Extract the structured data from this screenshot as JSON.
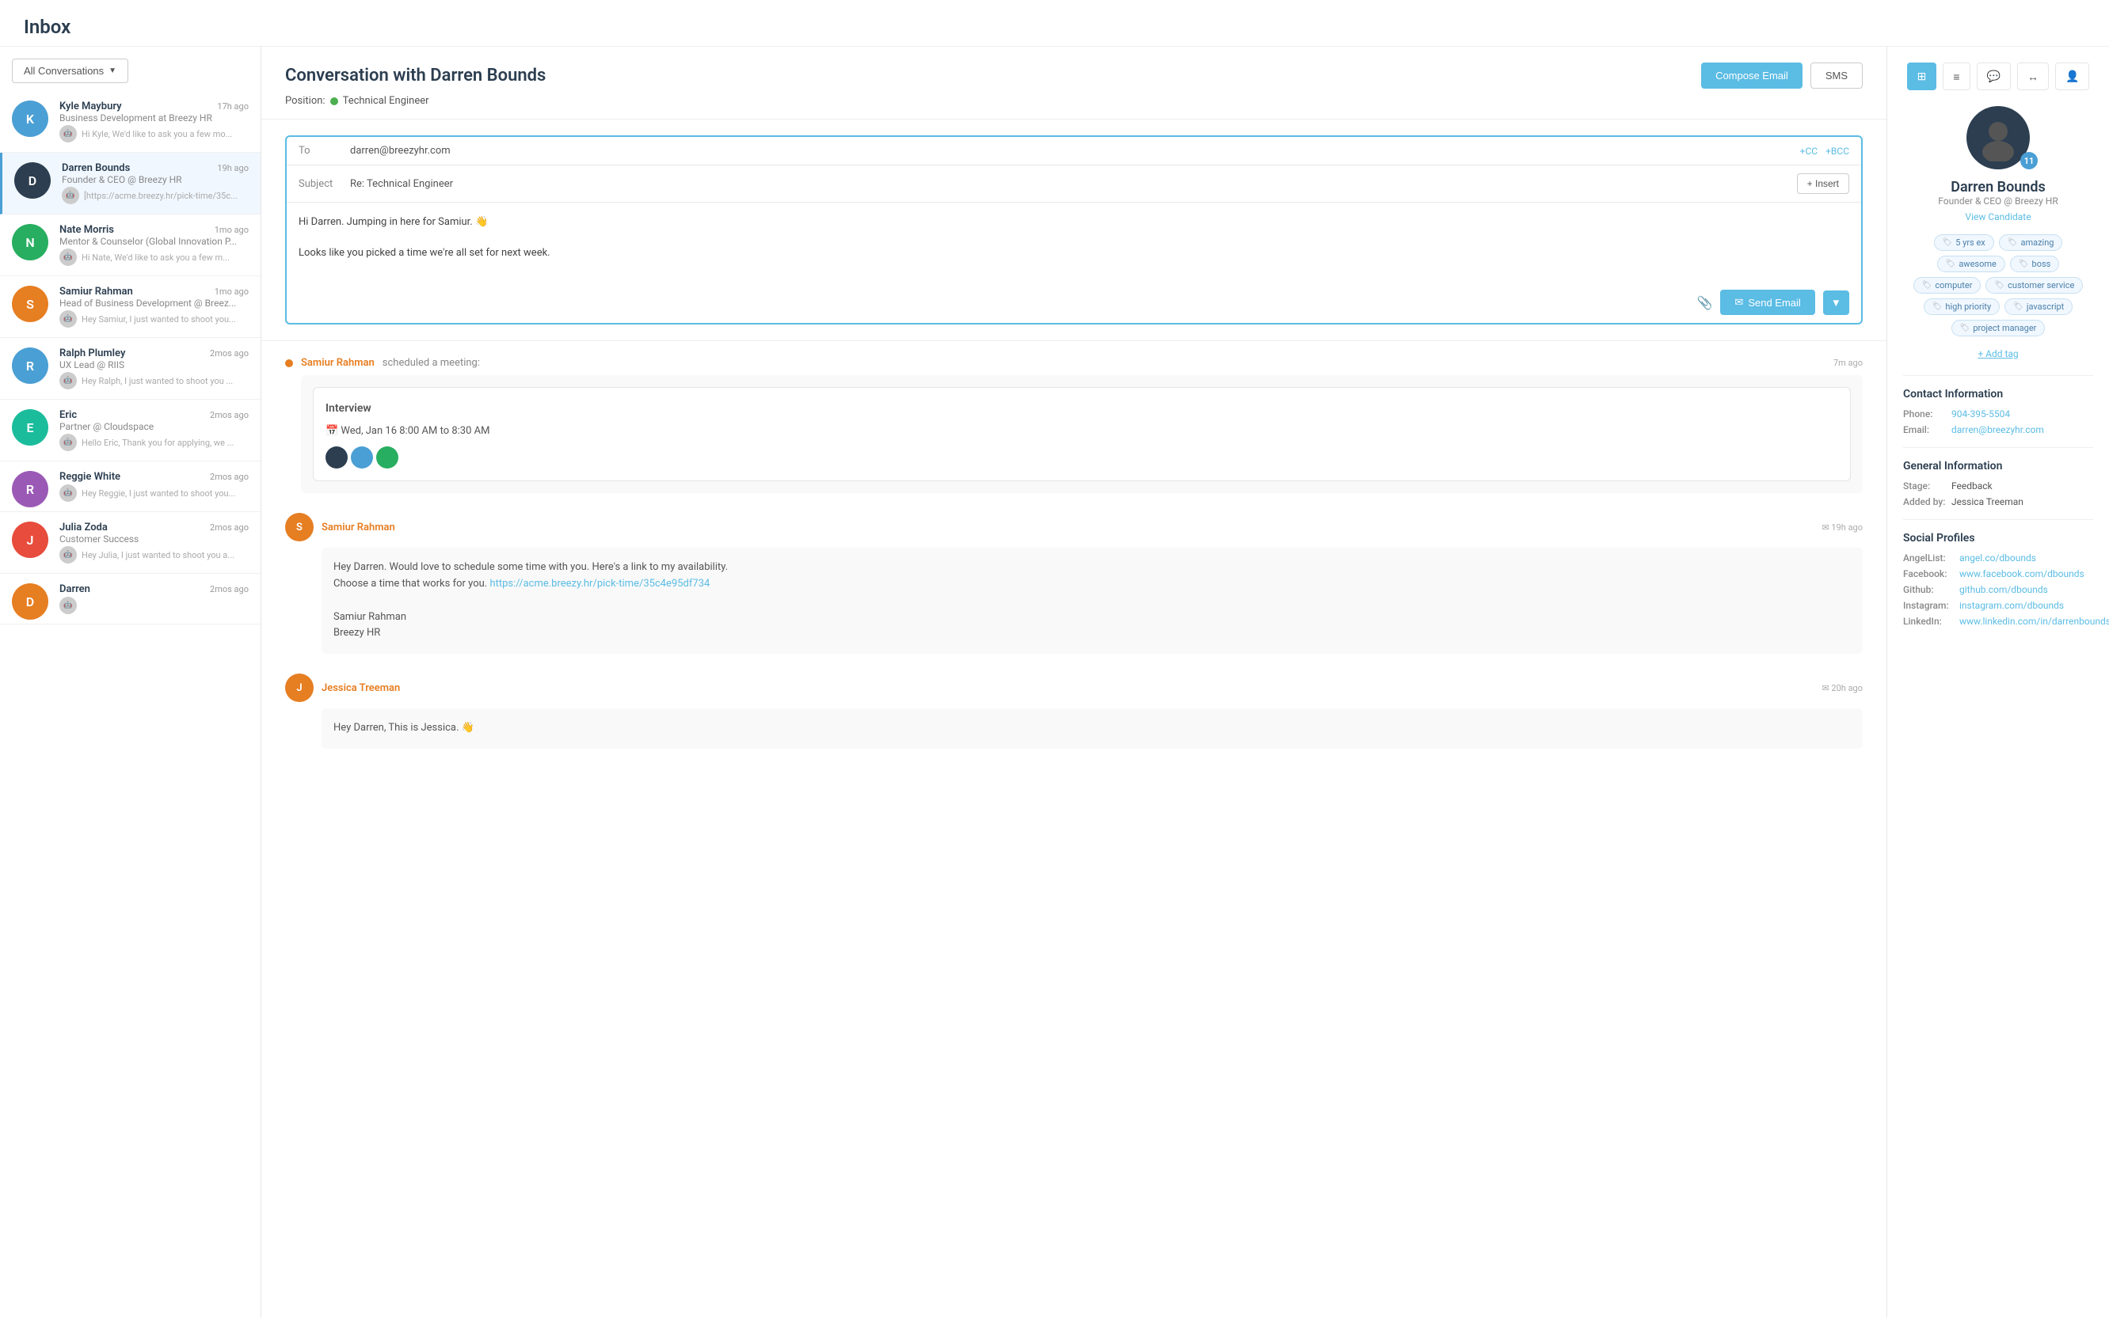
{
  "page": {
    "title": "Inbox"
  },
  "sidebar": {
    "filter_label": "All Conversations",
    "conversations": [
      {
        "id": "kyle",
        "name": "Kyle Maybury",
        "time": "17h ago",
        "subtitle": "Business Development at Breezy HR",
        "preview": "Hi Kyle, We'd like to ask you a few mo...",
        "initials": "K",
        "color": "av-blue",
        "active": false
      },
      {
        "id": "darren",
        "name": "Darren Bounds",
        "time": "19h ago",
        "subtitle": "Founder & CEO @ Breezy HR",
        "preview": "[https://acme.breezy.hr/pick-time/35c...",
        "initials": "D",
        "color": "av-dark",
        "active": true
      },
      {
        "id": "nate",
        "name": "Nate Morris",
        "time": "1mo ago",
        "subtitle": "Mentor & Counselor (Global Innovation P...",
        "preview": "Hi Nate, We'd like to ask you a few m...",
        "initials": "N",
        "color": "av-green",
        "active": false
      },
      {
        "id": "samiur",
        "name": "Samiur Rahman",
        "time": "1mo ago",
        "subtitle": "Head of Business Development @ Breez...",
        "preview": "Hey Samiur, I just wanted to shoot you...",
        "initials": "S",
        "color": "av-orange",
        "active": false
      },
      {
        "id": "ralph",
        "name": "Ralph Plumley",
        "time": "2mos ago",
        "subtitle": "UX Lead @ RIIS",
        "preview": "Hey Ralph, I just wanted to shoot you ...",
        "initials": "R",
        "color": "av-blue",
        "active": false
      },
      {
        "id": "eric",
        "name": "Eric",
        "time": "2mos ago",
        "subtitle": "Partner @ Cloudspace",
        "preview": "Hello Eric, Thank you for applying, we ...",
        "initials": "E",
        "color": "av-teal",
        "active": false
      },
      {
        "id": "reggie",
        "name": "Reggie White",
        "time": "2mos ago",
        "subtitle": "",
        "preview": "Hey Reggie, I just wanted to shoot you...",
        "initials": "R",
        "color": "av-purple",
        "active": false
      },
      {
        "id": "julia",
        "name": "Julia Zoda",
        "time": "2mos ago",
        "subtitle": "Customer Success",
        "preview": "Hey Julia, I just wanted to shoot you a...",
        "initials": "J",
        "color": "av-red",
        "active": false
      },
      {
        "id": "darren2",
        "name": "Darren",
        "time": "2mos ago",
        "subtitle": "",
        "preview": "",
        "initials": "D",
        "color": "av-orange",
        "active": false
      }
    ]
  },
  "conversation": {
    "title": "Conversation with Darren Bounds",
    "compose_email_label": "Compose Email",
    "sms_label": "SMS",
    "position_label": "Position:",
    "position_name": "Technical Engineer",
    "compose": {
      "to_label": "To",
      "to_value": "darren@breezyhr.com",
      "cc_label": "+CC",
      "bcc_label": "+BCC",
      "subject_label": "Subject",
      "subject_value": "Re: Technical Engineer",
      "insert_label": "+ Insert",
      "body_line1": "Hi Darren. Jumping in here for Samiur. 👋",
      "body_line2": "Looks like you picked a time we're all set for next week.",
      "send_label": "Send Email",
      "attachment_icon": "📎"
    },
    "messages": [
      {
        "id": "msg1",
        "type": "event",
        "sender": "Samiur Rahman",
        "action": "scheduled a meeting:",
        "time": "7m ago",
        "event_type": "meeting",
        "meeting_title": "Interview",
        "meeting_date": "Wed, Jan 16 8:00 AM to 8:30 AM",
        "has_orange_dot": true
      },
      {
        "id": "msg2",
        "type": "email",
        "sender": "Samiur Rahman",
        "time": "19h ago",
        "body": "Hey Darren. Would love to schedule some time with you. Here's a link to my availability.\nChoose a time that works for you. https://acme.breezy.hr/pick-time/35c4e95df734\n\nSamiur Rahman\nBreezy HR",
        "link_text": "https://acme.breezy.hr/pick-time/35c4e95df734",
        "has_email_icon": true
      },
      {
        "id": "msg3",
        "type": "email",
        "sender": "Jessica Treeman",
        "time": "20h ago",
        "body": "Hey Darren, This is Jessica. 👋",
        "has_email_icon": true
      }
    ]
  },
  "right_panel": {
    "icons": [
      "grid",
      "list",
      "chat",
      "arrows",
      "person"
    ],
    "badge_count": "11",
    "candidate_name": "Darren Bounds",
    "candidate_title": "Founder & CEO @ Breezy HR",
    "view_candidate_label": "View Candidate",
    "tags": [
      "5 yrs ex",
      "amazing",
      "awesome",
      "boss",
      "computer",
      "customer service",
      "high priority",
      "javascript",
      "project manager"
    ],
    "add_tag_label": "+ Add tag",
    "contact_section_title": "Contact Information",
    "phone_label": "Phone:",
    "phone_value": "904-395-5504",
    "email_label": "Email:",
    "email_value": "darren@breezyhr.com",
    "general_section_title": "General Information",
    "stage_label": "Stage:",
    "stage_value": "Feedback",
    "added_by_label": "Added by:",
    "added_by_value": "Jessica Treeman",
    "social_section_title": "Social Profiles",
    "social_links": [
      {
        "label": "AngelList:",
        "text": "angel.co/dbounds",
        "url": "#"
      },
      {
        "label": "Facebook:",
        "text": "www.facebook.com/dbounds",
        "url": "#"
      },
      {
        "label": "Github:",
        "text": "github.com/dbounds",
        "url": "#"
      },
      {
        "label": "Instagram:",
        "text": "instagram.com/dbounds",
        "url": "#"
      },
      {
        "label": "LinkedIn:",
        "text": "www.linkedin.com/in/darrenbounds",
        "url": "#"
      }
    ]
  }
}
